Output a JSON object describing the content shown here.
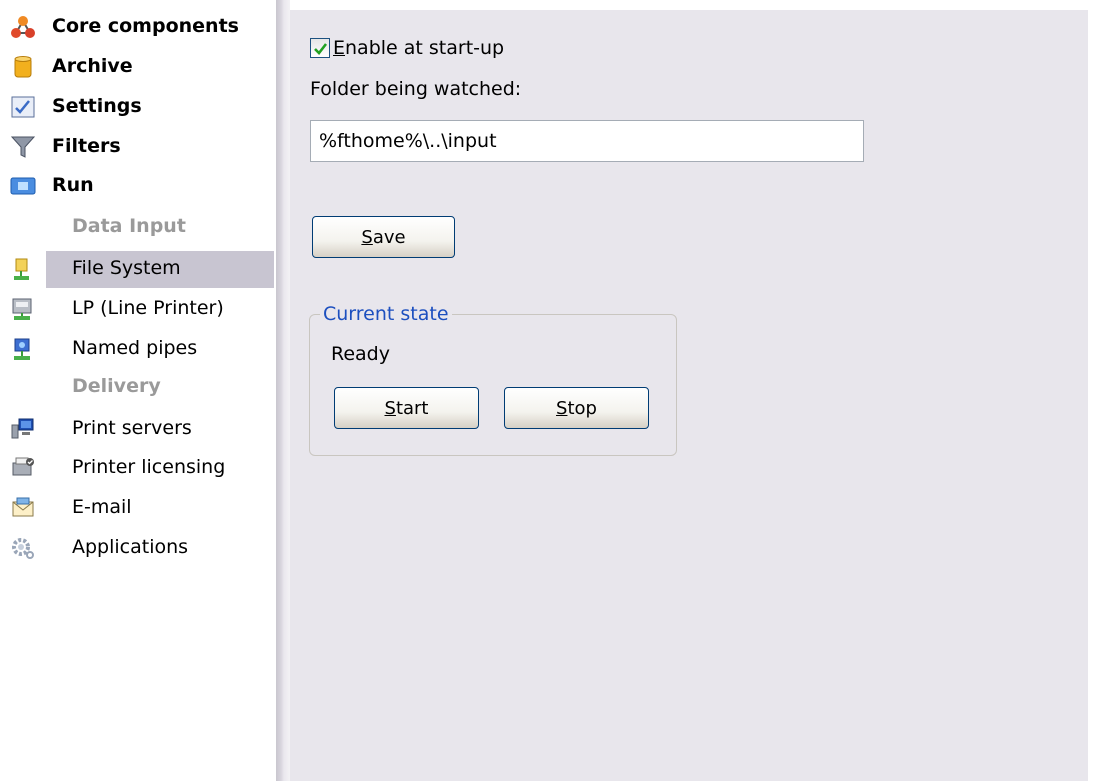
{
  "sidebar": {
    "items": [
      {
        "label": "Core components",
        "icon": "core-components-icon",
        "kind": "top"
      },
      {
        "label": "Archive",
        "icon": "archive-icon",
        "kind": "top"
      },
      {
        "label": "Settings",
        "icon": "settings-icon",
        "kind": "top"
      },
      {
        "label": "Filters",
        "icon": "filter-funnel-icon",
        "kind": "top"
      },
      {
        "label": "Run",
        "icon": "run-icon",
        "kind": "top"
      },
      {
        "label": "Data Input",
        "kind": "header"
      },
      {
        "label": "File System",
        "icon": "file-system-icon",
        "kind": "sub",
        "selected": true
      },
      {
        "label": "LP (Line Printer)",
        "icon": "line-printer-icon",
        "kind": "sub"
      },
      {
        "label": "Named pipes",
        "icon": "named-pipes-icon",
        "kind": "sub"
      },
      {
        "label": "Delivery",
        "kind": "header"
      },
      {
        "label": "Print servers",
        "icon": "print-servers-icon",
        "kind": "sub"
      },
      {
        "label": "Printer licensing",
        "icon": "printer-licensing-icon",
        "kind": "sub"
      },
      {
        "label": "E-mail",
        "icon": "email-icon",
        "kind": "sub"
      },
      {
        "label": "Applications",
        "icon": "applications-gear-icon",
        "kind": "sub"
      }
    ]
  },
  "panel": {
    "enable": {
      "checked": true,
      "label_first": "E",
      "label_rest": "nable at start-up"
    },
    "folder_label": "Folder being watched:",
    "folder_value": "%fthome%\\..\\input",
    "save": {
      "first": "S",
      "rest": "ave"
    },
    "state": {
      "legend": "Current state",
      "status": "Ready",
      "start": {
        "first": "S",
        "rest": "tart"
      },
      "stop": {
        "first": "S",
        "rest": "top"
      }
    }
  },
  "colors": {
    "panel_bg": "#e8e6ec",
    "selected_bg": "#c8c5d1",
    "legend_text": "#1c4fbf",
    "header_text": "#9a9a9a"
  }
}
